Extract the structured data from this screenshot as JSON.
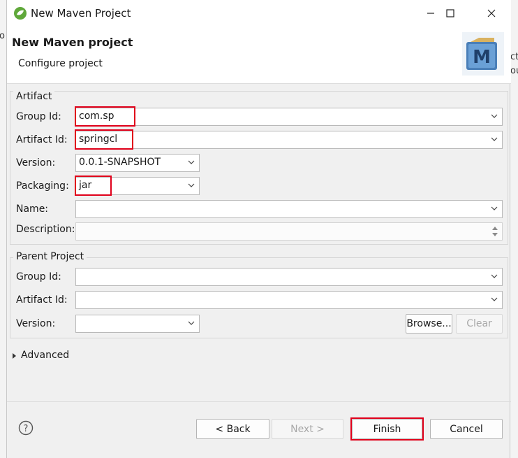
{
  "window": {
    "title": "New Maven Project"
  },
  "header": {
    "title": "New Maven project",
    "subtitle": "Configure project",
    "icon_letter": "M"
  },
  "artifact": {
    "legend": "Artifact",
    "group_id": {
      "label": "Group Id:",
      "value": "com.sp"
    },
    "artifact_id": {
      "label": "Artifact Id:",
      "value": "springcl"
    },
    "version": {
      "label": "Version:",
      "value": "0.0.1-SNAPSHOT"
    },
    "packaging": {
      "label": "Packaging:",
      "value": "jar"
    },
    "name": {
      "label": "Name:",
      "value": ""
    },
    "description": {
      "label": "Description:",
      "value": ""
    }
  },
  "parent": {
    "legend": "Parent Project",
    "group_id": {
      "label": "Group Id:",
      "value": ""
    },
    "artifact_id": {
      "label": "Artifact Id:",
      "value": ""
    },
    "version": {
      "label": "Version:",
      "value": ""
    },
    "browse_label": "Browse...",
    "clear_label": "Clear"
  },
  "advanced": {
    "label": "Advanced"
  },
  "footer": {
    "back_label": "< Back",
    "next_label": "Next >",
    "finish_label": "Finish",
    "cancel_label": "Cancel"
  },
  "background_fragments": {
    "left": "o",
    "right_top": "ct",
    "right_bottom": "ou"
  },
  "colors": {
    "highlight": "#e0001a",
    "dialog_bg": "#f0f0f0",
    "maven_icon": "#4a7fb8"
  }
}
